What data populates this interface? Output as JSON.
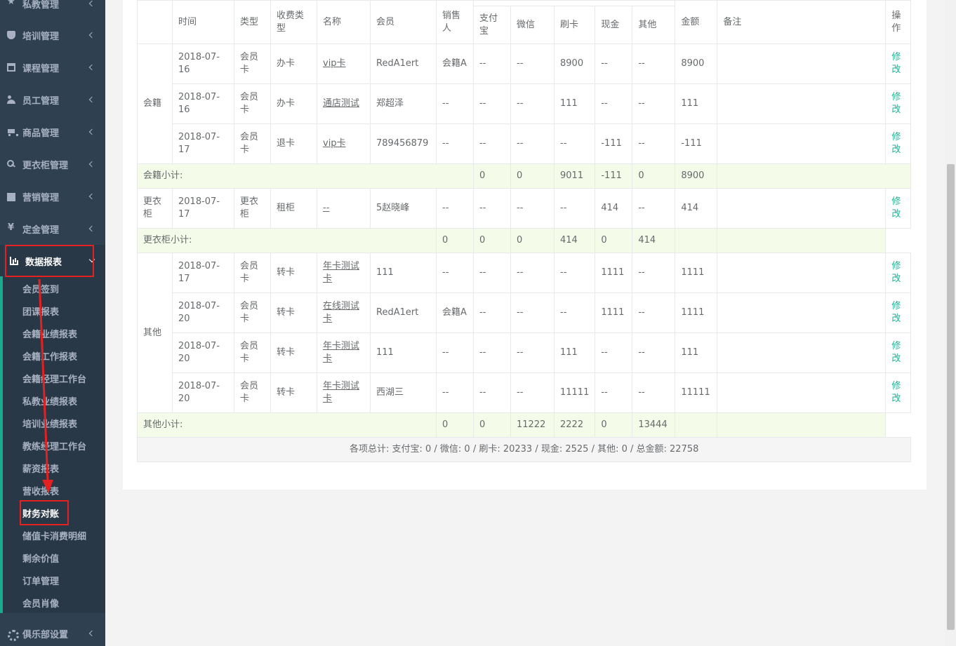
{
  "sidebar": {
    "items": [
      {
        "label": "私教管理",
        "icon": "star-icon"
      },
      {
        "label": "培训管理",
        "icon": "shield-icon"
      },
      {
        "label": "课程管理",
        "icon": "calendar-icon"
      },
      {
        "label": "员工管理",
        "icon": "users-icon"
      },
      {
        "label": "商品管理",
        "icon": "cart-icon"
      },
      {
        "label": "更衣柜管理",
        "icon": "key-icon"
      },
      {
        "label": "营销管理",
        "icon": "mail-icon"
      },
      {
        "label": "定金管理",
        "icon": "yen-icon"
      },
      {
        "label": "数据报表",
        "icon": "bar-chart-icon"
      }
    ],
    "sub_items": [
      "会员签到",
      "团课报表",
      "会籍业绩报表",
      "会籍工作报表",
      "会籍经理工作台",
      "私教业绩报表",
      "培训业绩报表",
      "教练经理工作台",
      "薪资报表",
      "营收报表",
      "财务对账",
      "储值卡消费明细",
      "剩余价值",
      "订单管理",
      "会员肖像"
    ],
    "bottom_item": {
      "label": "俱乐部设置",
      "icon": "gear-icon"
    }
  },
  "table": {
    "headers": {
      "time": "时间",
      "type": "类型",
      "fee_type": "收费类型",
      "name": "名称",
      "member": "会员",
      "seller": "销售人",
      "alipay": "支付宝",
      "wechat": "微信",
      "card": "刷卡",
      "cash": "现金",
      "other": "其他",
      "amount": "金额",
      "remark": "备注",
      "op": "操作"
    },
    "groups": {
      "membership": {
        "label": "会籍",
        "rows": [
          {
            "time": "2018-07-16",
            "type": "会员卡",
            "fee_type": "办卡",
            "name": "vip卡",
            "member": "RedA1ert",
            "seller": "会籍A",
            "alipay": "--",
            "wechat": "--",
            "card": "8900",
            "cash": "--",
            "other": "--",
            "amount": "8900",
            "op": "修改"
          },
          {
            "time": "2018-07-16",
            "type": "会员卡",
            "fee_type": "办卡",
            "name": "通店测试",
            "member": "郑超泽",
            "seller": "--",
            "alipay": "--",
            "wechat": "--",
            "card": "111",
            "cash": "--",
            "other": "--",
            "amount": "111",
            "op": "修改"
          },
          {
            "time": "2018-07-17",
            "type": "会员卡",
            "fee_type": "退卡",
            "name": "vip卡",
            "member": "789456879",
            "seller": "--",
            "alipay": "--",
            "wechat": "--",
            "card": "--",
            "cash": "-111",
            "other": "--",
            "amount": "-111",
            "op": "修改"
          }
        ],
        "subtotal": {
          "label": "会籍小计:",
          "alipay": "0",
          "wechat": "0",
          "card": "9011",
          "cash": "-111",
          "other": "0",
          "amount": "8900"
        }
      },
      "locker": {
        "label": "更衣柜",
        "rows": [
          {
            "time": "2018-07-17",
            "type": "更衣柜",
            "fee_type": "租柜",
            "name": "--",
            "member": "5赵晓峰",
            "seller": "--",
            "alipay": "--",
            "wechat": "--",
            "card": "--",
            "cash": "414",
            "other": "--",
            "amount": "414",
            "op": "修改"
          }
        ],
        "subtotal": {
          "label": "更衣柜小计:",
          "c1": "0",
          "c2": "0",
          "c3": "0",
          "c4": "414",
          "c5": "0",
          "c6": "414"
        }
      },
      "other": {
        "label": "其他",
        "rows": [
          {
            "time": "2018-07-17",
            "type": "会员卡",
            "fee_type": "转卡",
            "name": "年卡测试卡",
            "member": "111",
            "seller": "--",
            "alipay": "--",
            "wechat": "--",
            "card": "--",
            "cash": "1111",
            "other": "--",
            "amount": "1111",
            "op": "修改"
          },
          {
            "time": "2018-07-20",
            "type": "会员卡",
            "fee_type": "转卡",
            "name": "在线测试卡",
            "member": "RedA1ert",
            "seller": "会籍A",
            "alipay": "--",
            "wechat": "--",
            "card": "--",
            "cash": "1111",
            "other": "--",
            "amount": "1111",
            "op": "修改"
          },
          {
            "time": "2018-07-20",
            "type": "会员卡",
            "fee_type": "转卡",
            "name": "年卡测试卡",
            "member": "111",
            "seller": "--",
            "alipay": "--",
            "wechat": "--",
            "card": "111",
            "cash": "--",
            "other": "--",
            "amount": "111",
            "op": "修改"
          },
          {
            "time": "2018-07-20",
            "type": "会员卡",
            "fee_type": "转卡",
            "name": "年卡测试卡",
            "member": "西湖三",
            "seller": "--",
            "alipay": "--",
            "wechat": "--",
            "card": "11111",
            "cash": "--",
            "other": "--",
            "amount": "11111",
            "op": "修改"
          }
        ],
        "subtotal": {
          "label": "其他小计:",
          "c1": "0",
          "c2": "0",
          "c3": "11222",
          "c4": "2222",
          "c5": "0",
          "c6": "13444"
        }
      }
    },
    "grand_total": "各项总计:  支付宝: 0 / 微信: 0 / 刷卡: 20233 / 现金: 2525 / 其他: 0 / 总金额: 22758"
  },
  "colors": {
    "sidebar_bg": "#2f4050",
    "accent": "#1ab394",
    "annotation": "#e52020",
    "subtotal_bg": "#f4fbe9"
  }
}
